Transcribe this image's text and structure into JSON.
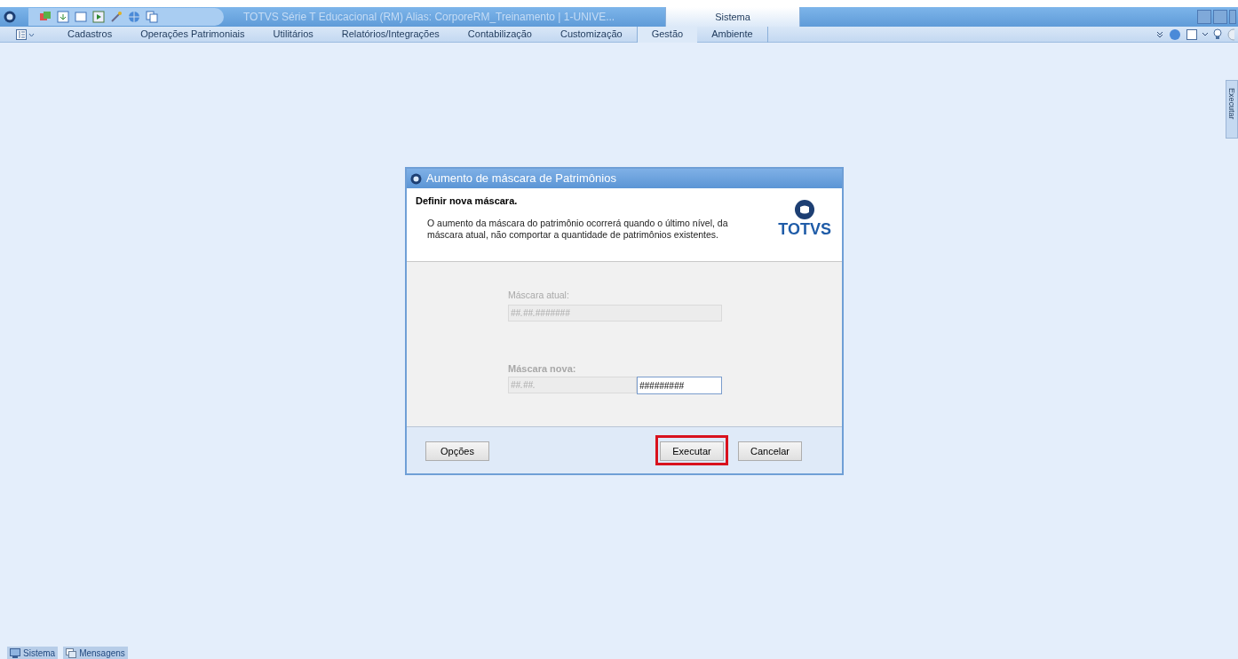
{
  "title_bar": {
    "title": "TOTVS Série T Educacional (RM) Alias: CorporeRM_Treinamento | 1-UNIVE...",
    "tabs": [
      {
        "label": "Sistema",
        "selected": true
      }
    ]
  },
  "menu_bar": {
    "items": [
      {
        "label": "Cadastros",
        "selected": false
      },
      {
        "label": "Operações Patrimoniais",
        "selected": false
      },
      {
        "label": "Utilitários",
        "selected": false
      },
      {
        "label": "Relatórios/Integrações",
        "selected": false
      },
      {
        "label": "Contabilização",
        "selected": false
      },
      {
        "label": "Customização",
        "selected": false
      },
      {
        "label": "Gestão",
        "selected": true
      },
      {
        "label": "Ambiente",
        "selected": false
      }
    ]
  },
  "side_tab": {
    "label": "Executar"
  },
  "dialog": {
    "title": "Aumento de máscara de Patrimônios",
    "heading": "Definir nova máscara.",
    "description": "O aumento da máscara do patrimônio ocorrerá quando o último nível, da máscara atual, não comportar a quantidade de patrimônios existentes.",
    "logo": "TOTVS",
    "current_mask": {
      "label": "Máscara atual:",
      "value": "##.##.#######"
    },
    "new_mask": {
      "label": "Máscara nova:",
      "prefix": "##.##.",
      "value": "#########"
    },
    "buttons": [
      {
        "label": "Opções",
        "highlighted": false
      },
      {
        "label": "Executar",
        "highlighted": true
      },
      {
        "label": "Cancelar",
        "highlighted": false
      }
    ]
  },
  "taskbar": [
    {
      "label": "Sistema",
      "kind": "system"
    },
    {
      "label": "Mensagens",
      "kind": "messages"
    }
  ]
}
